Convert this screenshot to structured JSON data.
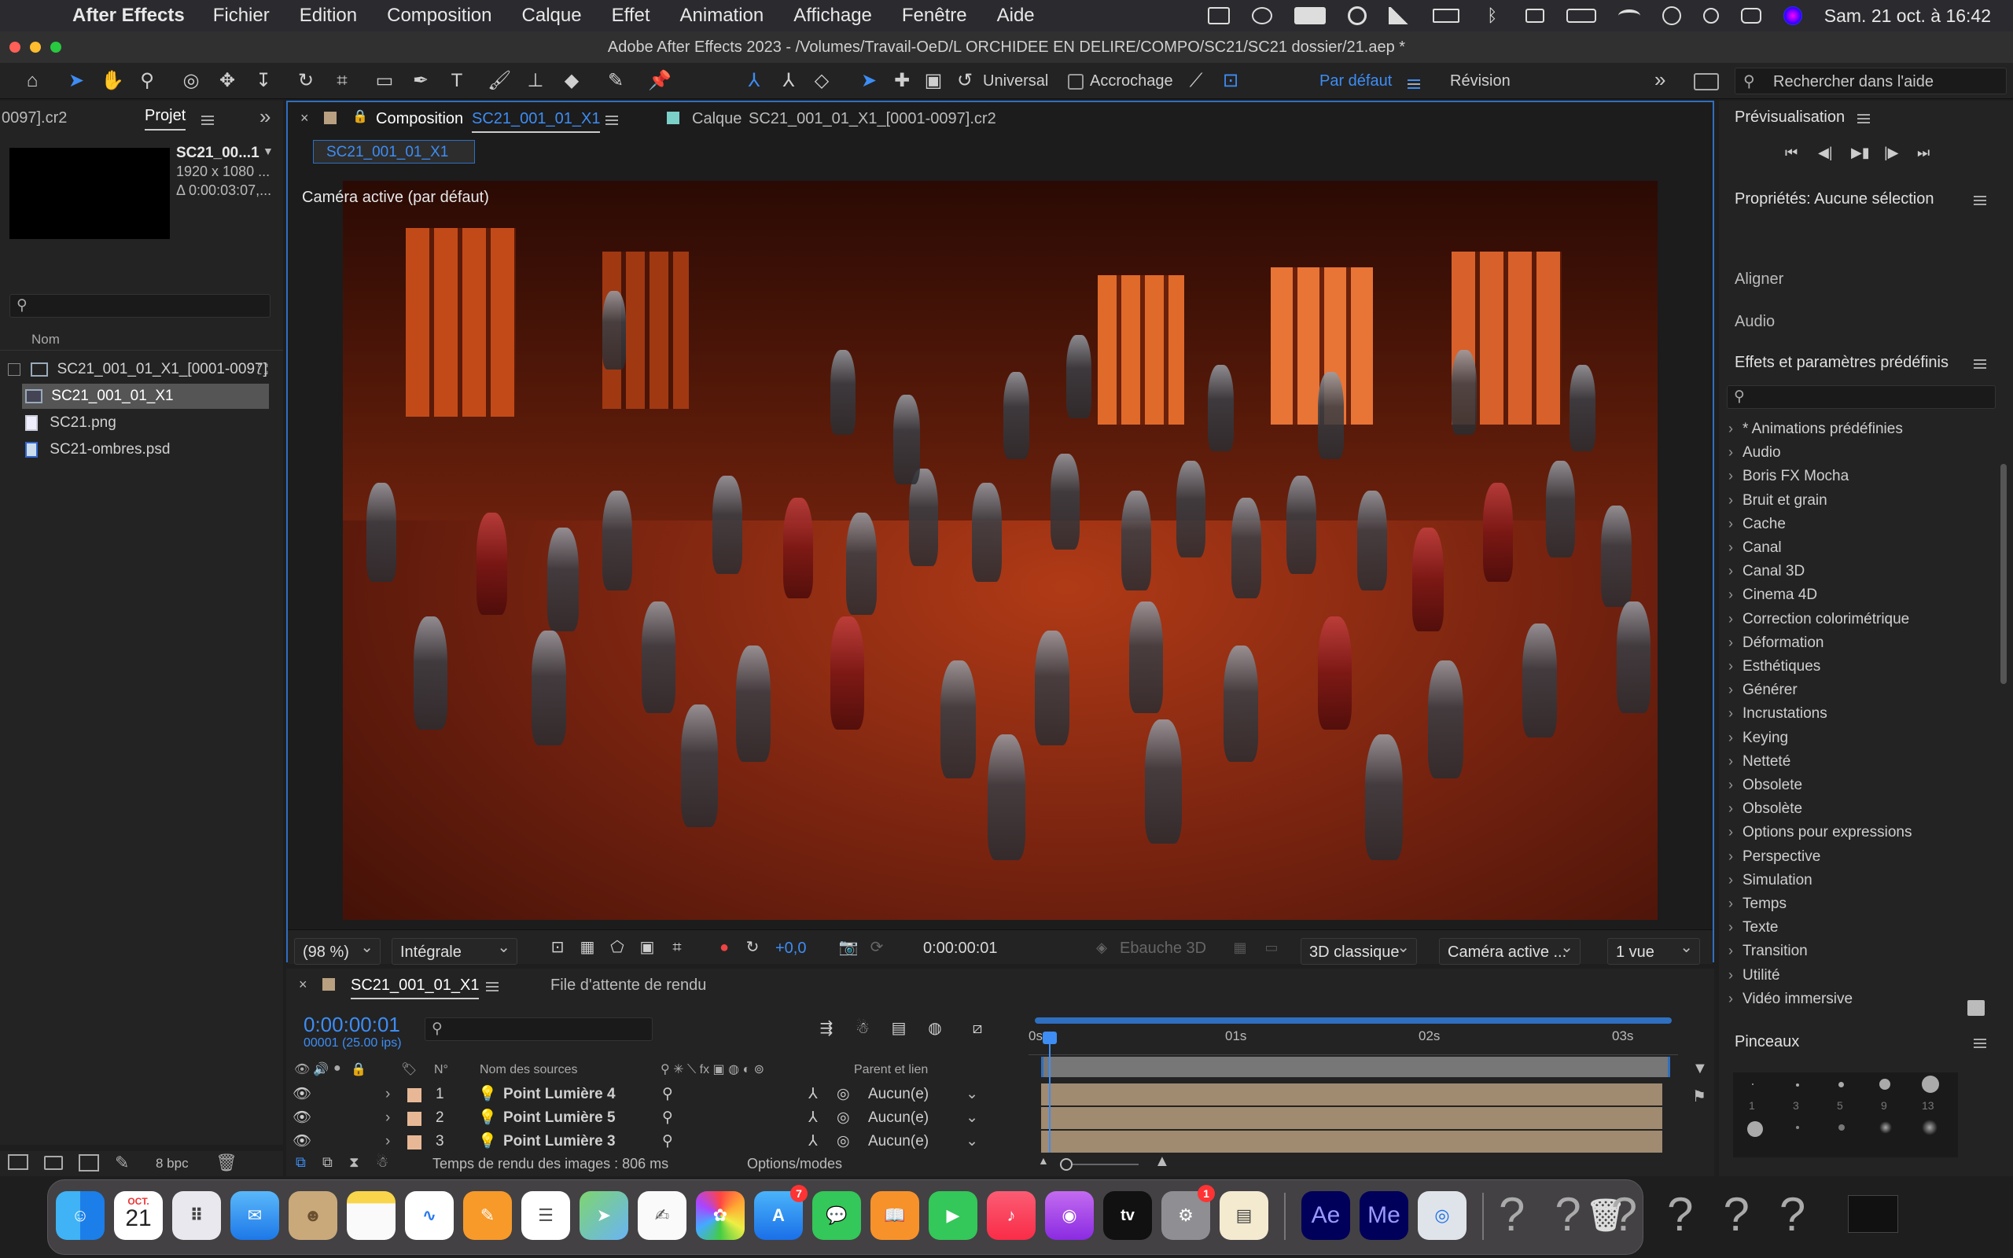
{
  "menubar": {
    "app_name": "After Effects",
    "menus": [
      "Fichier",
      "Edition",
      "Composition",
      "Calque",
      "Effet",
      "Animation",
      "Affichage",
      "Fenêtre",
      "Aide"
    ],
    "clock": "Sam. 21 oct. à 16:42"
  },
  "window": {
    "title": "Adobe After Effects 2023 - /Volumes/Travail-OeD/L ORCHIDEE EN DELIRE/COMPO/SC21/SC21 dossier/21.aep *"
  },
  "toolbar": {
    "axis_mode": "Universal",
    "snap_label": "Accrochage",
    "workspace_default": "Par défaut",
    "workspace_revision": "Révision",
    "help_search_placeholder": "Rechercher dans l'aide"
  },
  "project": {
    "tab_truncated": "0097].cr2",
    "tab_label": "Projet",
    "thumb_name": "SC21_00...1",
    "thumb_res": "1920 x 1080 ...",
    "thumb_dur": "Δ 0:00:03:07,...",
    "col_name": "Nom",
    "items": [
      {
        "name": "SC21_001_01_X1_[0001-0097]",
        "icon": "image-sequence-icon"
      },
      {
        "name": "SC21_001_01_X1",
        "icon": "composition-icon"
      },
      {
        "name": "SC21.png",
        "icon": "file-icon"
      },
      {
        "name": "SC21-ombres.psd",
        "icon": "psd-file-icon"
      }
    ],
    "bpc": "8 bpc"
  },
  "viewer": {
    "comp_tab_prefix": "Composition",
    "comp_tab_name": "SC21_001_01_X1",
    "layer_tab_prefix": "Calque",
    "layer_tab_name": "SC21_001_01_X1_[0001-0097].cr2",
    "sub_tab": "SC21_001_01_X1",
    "camera_label": "Caméra active (par défaut)",
    "zoom": "(98 %)",
    "resolution": "Intégrale",
    "exposure": "+0,0",
    "timecode": "0:00:00:01",
    "draft3d": "Ebauche 3D",
    "renderer": "3D classique",
    "camera": "Caméra active ...",
    "views": "1 vue"
  },
  "timeline": {
    "tab_name": "SC21_001_01_X1",
    "render_queue": "File d'attente de rendu",
    "current_time": "0:00:00:01",
    "frame_info": "00001 (25.00 ips)",
    "col_num": "N°",
    "col_source": "Nom des sources",
    "col_parent": "Parent et lien",
    "ruler": [
      "0s",
      "01s",
      "02s",
      "03s"
    ],
    "layers": [
      {
        "num": "1",
        "name": "Point Lumière 4",
        "parent": "Aucun(e)"
      },
      {
        "num": "2",
        "name": "Point Lumière 5",
        "parent": "Aucun(e)"
      },
      {
        "num": "3",
        "name": "Point Lumière 3",
        "parent": "Aucun(e)"
      }
    ],
    "render_time": "Temps de rendu des images : 806 ms",
    "options_modes": "Options/modes"
  },
  "right_panels": {
    "preview": "Prévisualisation",
    "properties": "Propriétés: Aucune sélection",
    "align": "Aligner",
    "audio": "Audio",
    "effects_title": "Effets et paramètres prédéfinis",
    "effects": [
      "* Animations prédéfinies",
      "Audio",
      "Boris FX Mocha",
      "Bruit et grain",
      "Cache",
      "Canal",
      "Canal 3D",
      "Cinema 4D",
      "Correction colorimétrique",
      "Déformation",
      "Esthétiques",
      "Générer",
      "Incrustations",
      "Keying",
      "Netteté",
      "Obsolete",
      "Obsolète",
      "Options pour expressions",
      "Perspective",
      "Simulation",
      "Temps",
      "Texte",
      "Transition",
      "Utilité",
      "Vidéo immersive"
    ],
    "brushes": "Pinceaux",
    "brush_sizes": [
      "1",
      "3",
      "5",
      "9",
      "13"
    ]
  },
  "dock": {
    "calendar_month": "OCT.",
    "calendar_day": "21",
    "appstore_badge": "7",
    "settings_badge": "1",
    "ae_label": "Ae",
    "me_label": "Me",
    "tv_label": "tv"
  },
  "colors": {
    "accent": "#3d8df5",
    "panel": "#232323",
    "layer_label": "#e8b896"
  }
}
